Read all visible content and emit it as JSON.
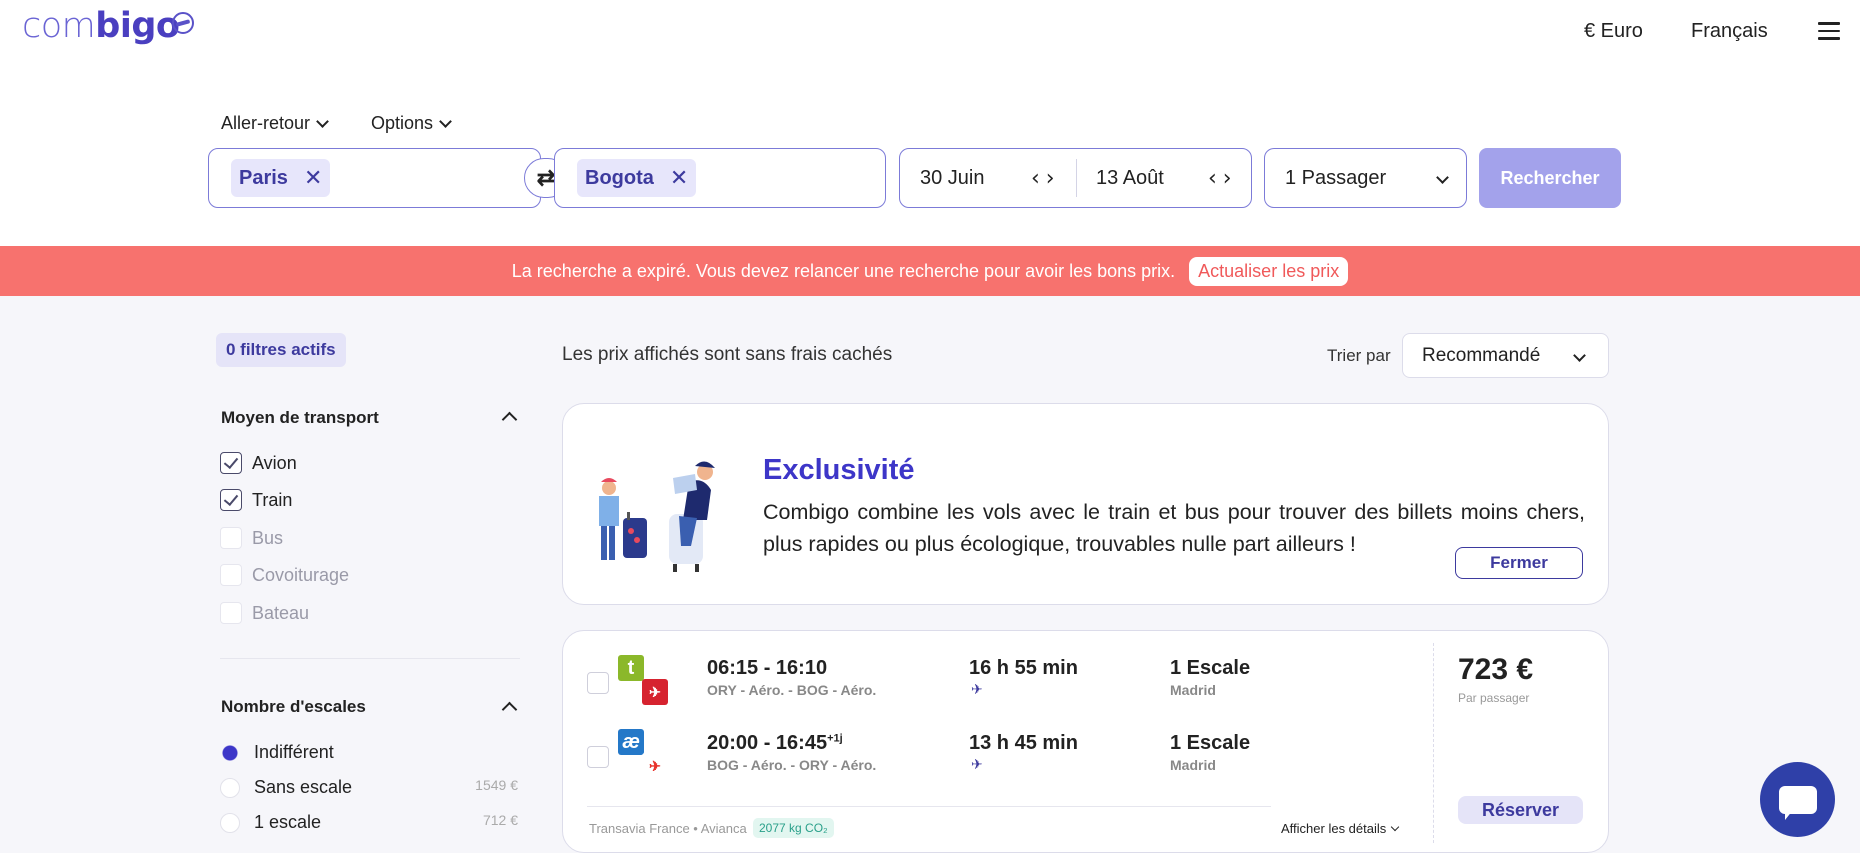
{
  "header": {
    "logo_light": "com",
    "logo_bold": "bigo",
    "currency": "€ Euro",
    "language": "Français"
  },
  "search": {
    "trip_type": "Aller-retour",
    "options": "Options",
    "origin": "Paris",
    "destination": "Bogota",
    "date_out": "30 Juin",
    "date_back": "13 Août",
    "passengers": "1 Passager",
    "submit": "Rechercher"
  },
  "banner": {
    "message": "La recherche a expiré. Vous devez relancer une recherche pour avoir les bons prix.",
    "action": "Actualiser les prix"
  },
  "sidebar": {
    "active_filters": "0 filtres actifs",
    "transport_title": "Moyen de transport",
    "transport": [
      {
        "label": "Avion",
        "checked": true
      },
      {
        "label": "Train",
        "checked": true
      },
      {
        "label": "Bus",
        "checked": false
      },
      {
        "label": "Covoiturage",
        "checked": false
      },
      {
        "label": "Bateau",
        "checked": false
      }
    ],
    "stops_title": "Nombre d'escales",
    "stops": [
      {
        "label": "Indifférent",
        "price": "",
        "selected": true
      },
      {
        "label": "Sans escale",
        "price": "1549 €",
        "selected": false
      },
      {
        "label": "1 escale",
        "price": "712 €",
        "selected": false
      }
    ]
  },
  "main": {
    "note": "Les prix affichés sont sans frais cachés",
    "sort_label": "Trier par",
    "sort_value": "Recommandé",
    "exclusive": {
      "title": "Exclusivité",
      "text": "Combigo combine les vols avec le train et bus pour trouver des billets moins chers, plus rapides ou plus écologique, trouvables nulle part ailleurs !",
      "close": "Fermer"
    },
    "result": {
      "legs": [
        {
          "time": "06:15 - 16:10",
          "plus": "",
          "route": "ORY - Aéro. - BOG - Aéro.",
          "duration": "16 h 55 min",
          "stops": "1 Escale",
          "via": "Madrid",
          "logo_a": "t",
          "logo_b": "✈"
        },
        {
          "time": "20:00 - 16:45",
          "plus": "+1j",
          "route": "BOG - Aéro. - ORY - Aéro.",
          "duration": "13 h 45 min",
          "stops": "1 Escale",
          "via": "Madrid",
          "logo_a": "æ",
          "logo_b": "✈"
        }
      ],
      "airlines": "Transavia France • Avianca",
      "co2": "2077 kg CO₂",
      "details": "Afficher les détails",
      "price": "723 €",
      "per": "Par passager",
      "book": "Réserver"
    }
  },
  "colors": {
    "accent": "#3d36c8",
    "banner": "#f7726e",
    "button": "#a3a2eb"
  }
}
